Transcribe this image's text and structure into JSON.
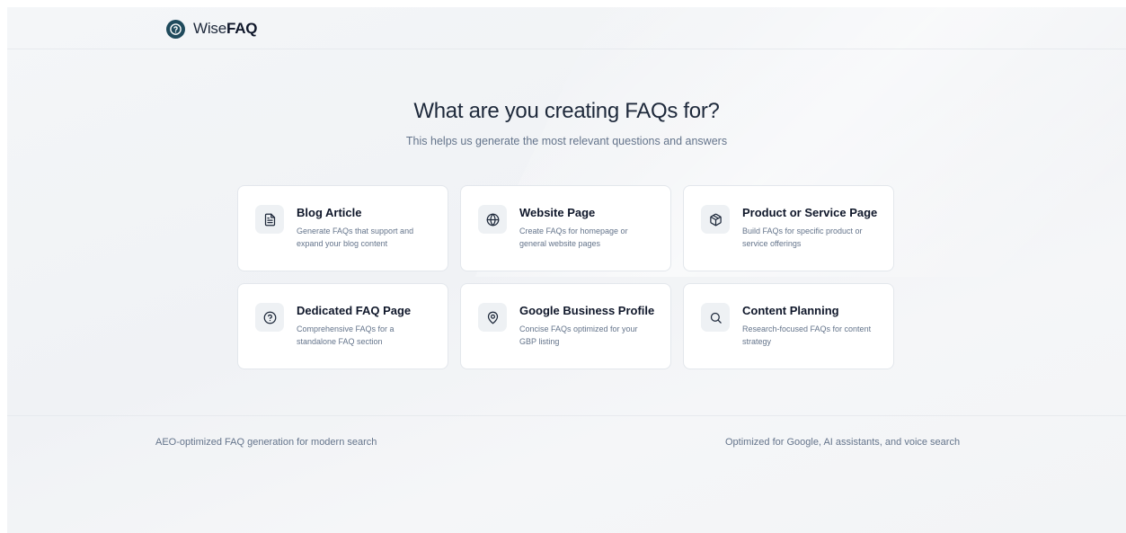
{
  "brand": {
    "name_light": "Wise",
    "name_bold": "FAQ"
  },
  "hero": {
    "title": "What are you creating FAQs for?",
    "subtitle": "This helps us generate the most relevant questions and answers"
  },
  "options": [
    {
      "icon": "document-icon",
      "title": "Blog Article",
      "description": "Generate FAQs that support and expand your blog content"
    },
    {
      "icon": "globe-icon",
      "title": "Website Page",
      "description": "Create FAQs for homepage or general website pages"
    },
    {
      "icon": "package-icon",
      "title": "Product or Service Page",
      "description": "Build FAQs for specific product or service offerings"
    },
    {
      "icon": "help-circle-icon",
      "title": "Dedicated FAQ Page",
      "description": "Comprehensive FAQs for a standalone FAQ section"
    },
    {
      "icon": "map-pin-icon",
      "title": "Google Business Profile",
      "description": "Concise FAQs optimized for your GBP listing"
    },
    {
      "icon": "search-icon",
      "title": "Content Planning",
      "description": "Research-focused FAQs for content strategy"
    }
  ],
  "footer": {
    "left": "AEO-optimized FAQ generation for modern search",
    "right": "Optimized for Google, AI assistants, and voice search"
  },
  "colors": {
    "brand": "#1f4a5c",
    "title_text": "#0f172a",
    "muted_text": "#64748b",
    "card_border": "#e3e7ec",
    "icon_tile": "#eef1f4"
  }
}
